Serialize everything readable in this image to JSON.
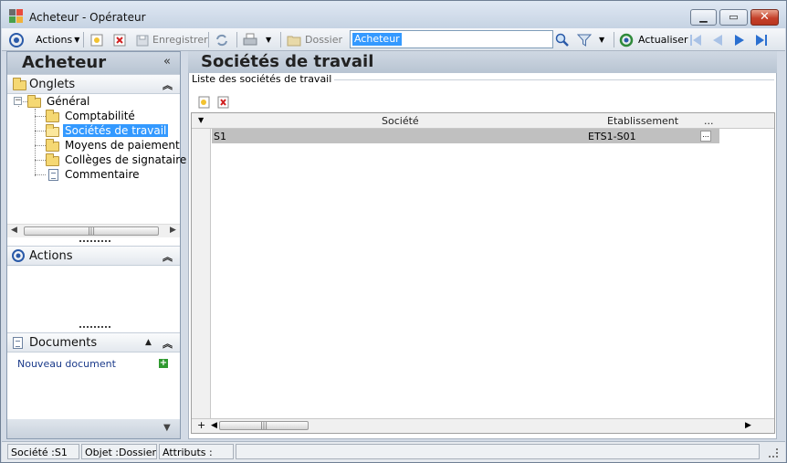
{
  "window": {
    "title": "Acheteur -  Opérateur",
    "minimize": "▁",
    "maximize": "▭",
    "close": "✕"
  },
  "toolbar": {
    "actions_label": "Actions",
    "save_label": "Enregistrer",
    "folder_label": "Dossier",
    "search_value": "Acheteur",
    "refresh_label": "Actualiser"
  },
  "left_panel": {
    "title": "Acheteur",
    "collapse": "«",
    "tabs_section": "Onglets",
    "actions_section": "Actions",
    "documents_section": "Documents",
    "tree": {
      "root": "Général",
      "items": [
        {
          "label": "Comptabilité",
          "selected": false
        },
        {
          "label": "Sociétés de travail",
          "selected": true
        },
        {
          "label": "Moyens de paiement",
          "selected": false
        },
        {
          "label": "Collèges de signataire",
          "selected": false
        },
        {
          "label": "Commentaire",
          "selected": false
        }
      ]
    },
    "new_document": "Nouveau document"
  },
  "main": {
    "title": "Sociétés de travail",
    "group_label": "Liste des sociétés de travail",
    "grid": {
      "columns": [
        "Société",
        "Etablissement",
        "..."
      ],
      "rows": [
        {
          "societe": "S1",
          "etablissement": "ETS1-S01",
          "more": "..."
        }
      ],
      "add_row": "+"
    }
  },
  "statusbar": {
    "societe": "Société :S1",
    "objet": "Objet :Dossier",
    "attributs": "Attributs :"
  },
  "colors": {
    "accent": "#3399ff",
    "header_bg": "#c4cfdc",
    "window_bg": "#d3dbe6"
  }
}
